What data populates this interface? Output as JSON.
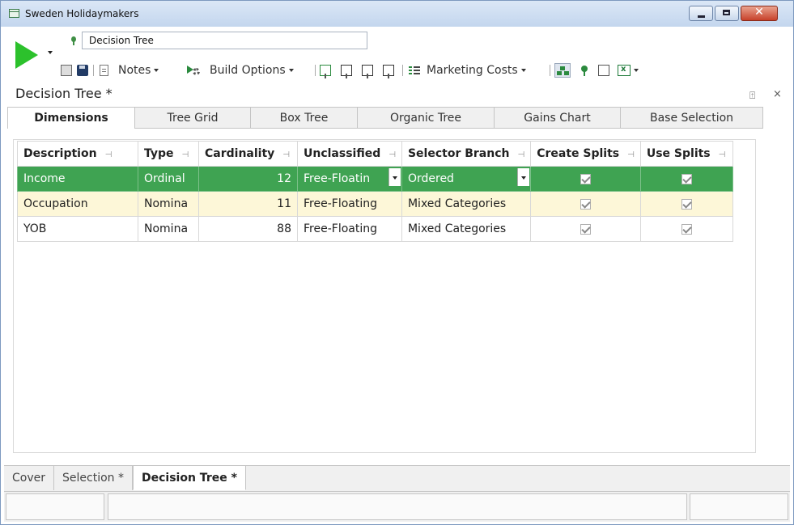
{
  "window": {
    "title": "Sweden Holidaymakers"
  },
  "header": {
    "object_name": "Decision Tree"
  },
  "toolbar": {
    "notes_label": "Notes",
    "build_options_label": "Build Options",
    "marketing_costs_label": "Marketing Costs"
  },
  "panel": {
    "title": "Decision Tree *",
    "pin_glyph": "⍐",
    "close_glyph": "×"
  },
  "tabs": [
    {
      "label": "Dimensions",
      "active": true
    },
    {
      "label": "Tree Grid"
    },
    {
      "label": "Box Tree"
    },
    {
      "label": "Organic Tree"
    },
    {
      "label": "Gains Chart"
    },
    {
      "label": "Base Selection"
    }
  ],
  "grid": {
    "columns": [
      "Description",
      "Type",
      "Cardinality",
      "Unclassified",
      "Selector Branch",
      "Create Splits",
      "Use Splits"
    ],
    "rows": [
      {
        "description": "Income",
        "type": "Ordinal",
        "cardinality": "12",
        "unclassified": "Free-Floatin",
        "selector_branch": "Ordered",
        "create_splits": true,
        "use_splits": true,
        "selected": true
      },
      {
        "description": "Occupation",
        "type": "Nomina",
        "cardinality": "11",
        "unclassified": "Free-Floating",
        "selector_branch": "Mixed Categories",
        "create_splits": true,
        "use_splits": true
      },
      {
        "description": "YOB",
        "type": "Nomina",
        "cardinality": "88",
        "unclassified": "Free-Floating",
        "selector_branch": "Mixed Categories",
        "create_splits": true,
        "use_splits": true
      }
    ]
  },
  "bottom_tabs": [
    {
      "label": "Cover"
    },
    {
      "label": "Selection *"
    },
    {
      "label": "Decision Tree *",
      "active": true
    }
  ],
  "colors": {
    "selected_row": "#3fa352",
    "alt_row": "#fdf7d8",
    "run_button": "#2cc12c"
  }
}
